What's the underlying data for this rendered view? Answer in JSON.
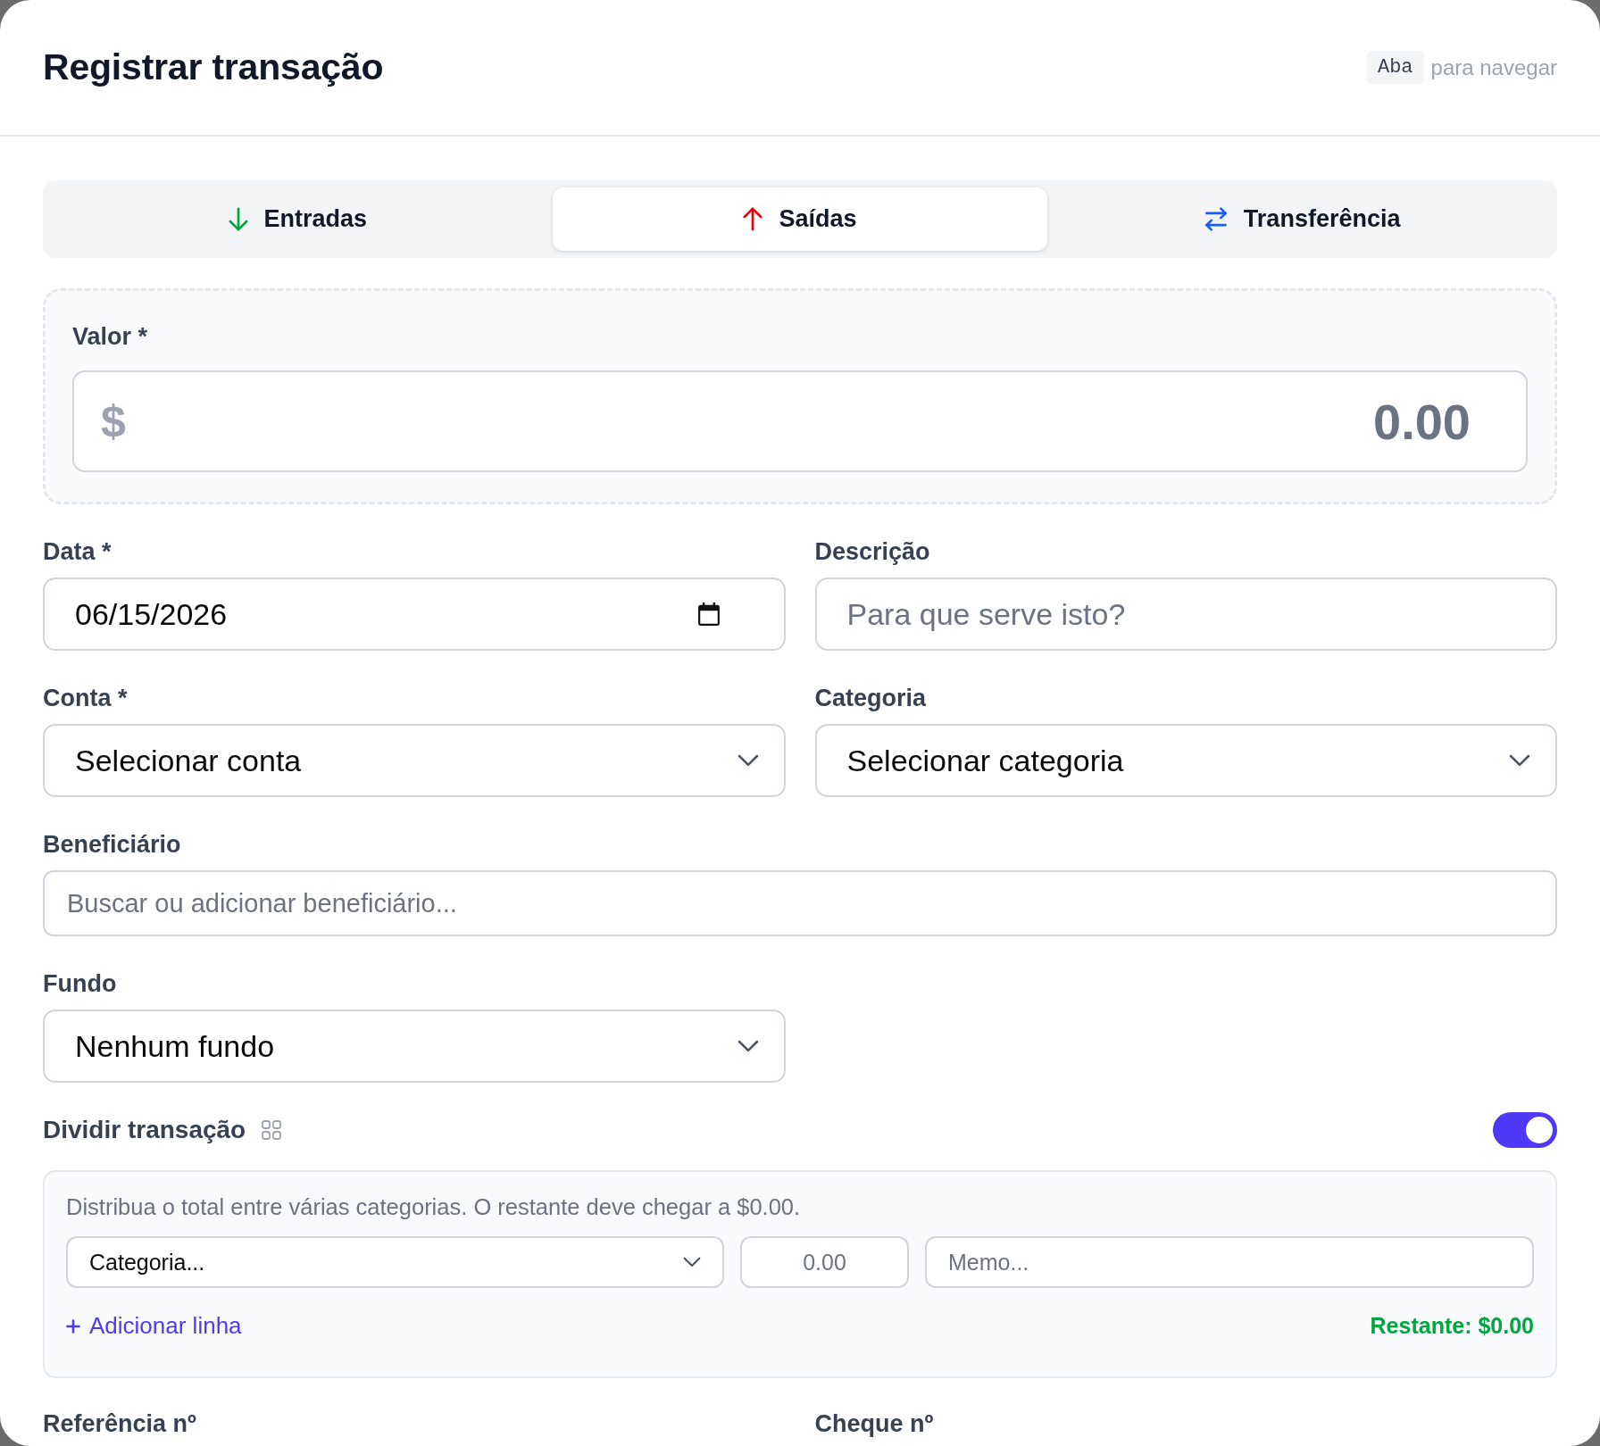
{
  "dialog": {
    "title": "Registrar transação",
    "shortcut": {
      "key": "Aba",
      "text": "para navegar"
    }
  },
  "tabs": [
    {
      "label": "Entradas",
      "kind": "income",
      "selected": false
    },
    {
      "label": "Saídas",
      "kind": "expense",
      "selected": true
    },
    {
      "label": "Transferência",
      "kind": "transfer",
      "selected": false
    }
  ],
  "amount": {
    "label": "Valor *",
    "currency": "$",
    "placeholder": "0.00"
  },
  "fields": [
    {
      "kind": "date",
      "label": "Data *",
      "value": "06/15/2026"
    },
    {
      "kind": "text",
      "label": "Descrição",
      "placeholder": "Para que serve isto?"
    },
    {
      "kind": "select",
      "label": "Conta *",
      "value": "Selecionar conta"
    },
    {
      "kind": "select",
      "label": "Categoria",
      "value": "Selecionar categoria"
    },
    {
      "kind": "search",
      "label": "Beneficiário",
      "placeholder": "Buscar ou adicionar beneficiário..."
    },
    {
      "kind": "select",
      "label": "Fundo",
      "value": "Nenhum fundo"
    }
  ],
  "split": {
    "label": "Dividir transação",
    "on": true,
    "hint": "Distribua o total entre várias categorias. O restante deve chegar a $0.00.",
    "lines": [
      {
        "category": "Categoria...",
        "amount_placeholder": "0.00",
        "memo_placeholder": "Memo..."
      }
    ],
    "add_label": "Adicionar linha",
    "remaining": "Restante: $0.00",
    "balanced": true
  },
  "next_fields": [
    {
      "label": "Referência nº"
    },
    {
      "label": "Cheque nº"
    }
  ]
}
